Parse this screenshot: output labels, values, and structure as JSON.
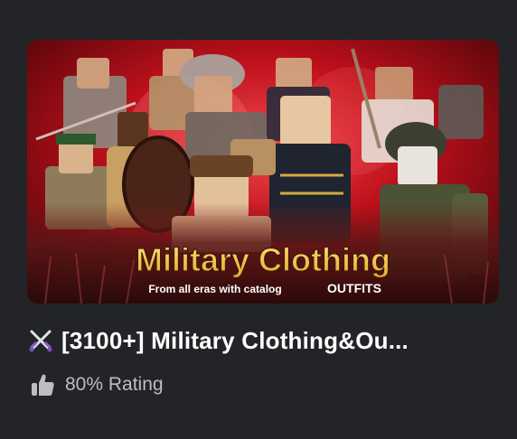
{
  "game": {
    "thumbnail": {
      "title_line": "Military Clothing",
      "subtitle": "From all eras with catalog",
      "badge": "OUTFITS",
      "accent_red": "#c0101c",
      "title_gold": "#f2c443"
    },
    "title": "[3100+] Military Clothing&Ou...",
    "title_icon": "crossed-swords-icon",
    "rating_icon": "thumbs-up-icon",
    "rating_label": "80% Rating"
  },
  "colors": {
    "background": "#232427",
    "title_text": "#ffffff",
    "rating_text": "#bdbec1"
  }
}
